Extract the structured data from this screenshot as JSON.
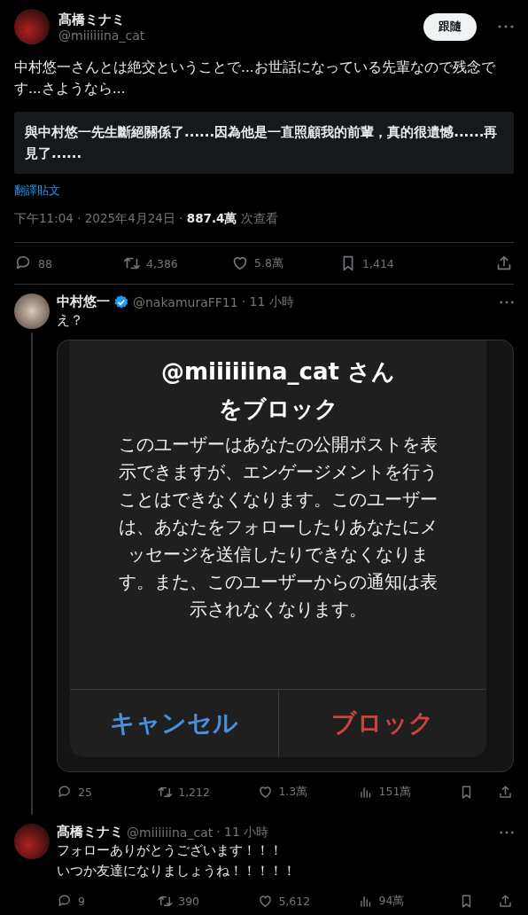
{
  "post": {
    "author": {
      "name": "髙橋ミナミ",
      "handle": "@miiiiiina_cat"
    },
    "follow_button": "跟隨",
    "text": "中村悠一さんとは絶交ということで...お世話になっている先輩なので残念です...さようなら...",
    "translation": "與中村悠一先生斷絕關係了......因為他是一直照顧我的前輩，真的很遺憾......再見了......",
    "translate_link": "翻譯貼文",
    "meta": "下午11:04 · 2025年4月24日 · **887.4萬** 次查看",
    "actions": [
      {
        "kind": "reply",
        "count": "88"
      },
      {
        "kind": "repost",
        "count": "4,386"
      },
      {
        "kind": "like",
        "count": "5.8萬"
      },
      {
        "kind": "bookmark",
        "count": "1,414"
      },
      {
        "kind": "share"
      }
    ]
  },
  "replies": [
    {
      "name": "中村悠一",
      "verified": true,
      "handle": "@nakamuraFF11",
      "time": "· 11 小時",
      "text": [
        "え？"
      ],
      "image": {
        "dialog": {
          "title": [
            "@miiiiiina_cat さん",
            "をブロック"
          ],
          "message": "このユーザーはあなたの公開ポストを表示できますが、エンゲージメントを行うことはできなくなります。このユーザーは、あなたをフォローしたりあなたにメッセージを送信したりできなくなります。また、このユーザーからの通知は表示されなくなります。",
          "buttons": [
            {
              "label": "キャンセル",
              "kind": "cancel"
            },
            {
              "label": "ブロック",
              "kind": "destructive"
            }
          ]
        }
      },
      "actions": [
        {
          "kind": "reply",
          "count": "25"
        },
        {
          "kind": "repost",
          "count": "1,212"
        },
        {
          "kind": "like",
          "count": "1.3萬"
        },
        {
          "kind": "views",
          "count": "151萬"
        },
        {
          "kind": "bookmark"
        },
        {
          "kind": "share"
        }
      ]
    },
    {
      "name": "髙橋ミナミ",
      "verified": false,
      "handle": "@miiiiiina_cat",
      "time": "· 11 小時",
      "text": [
        "フォローありがとうございます！！！",
        "いつか友達になりましょうね！！！！！"
      ],
      "actions": [
        {
          "kind": "reply",
          "count": "9"
        },
        {
          "kind": "repost",
          "count": "390"
        },
        {
          "kind": "like",
          "count": "5,612"
        },
        {
          "kind": "views",
          "count": "94萬"
        },
        {
          "kind": "bookmark"
        },
        {
          "kind": "share"
        }
      ]
    }
  ]
}
